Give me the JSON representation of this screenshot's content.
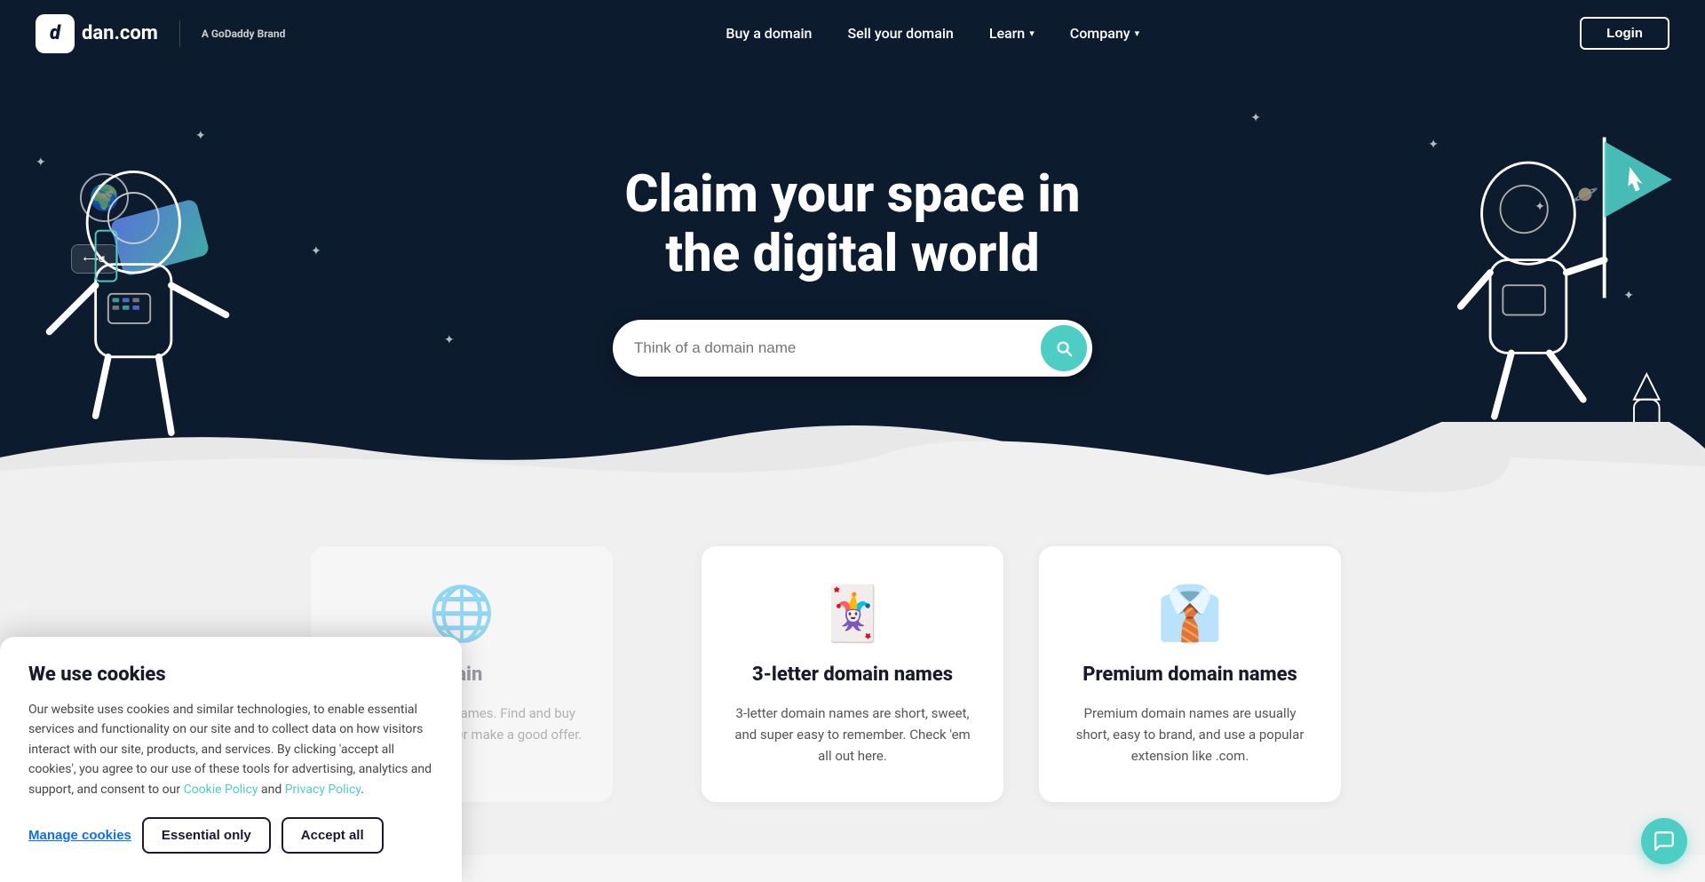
{
  "nav": {
    "logo_text": "dan.com",
    "logo_letter": "d",
    "godaddy_prefix": "A ",
    "godaddy_brand": "GoDaddy",
    "godaddy_suffix": " Brand",
    "links": [
      {
        "label": "Buy a domain",
        "has_dropdown": false
      },
      {
        "label": "Sell your domain",
        "has_dropdown": false
      },
      {
        "label": "Learn",
        "has_dropdown": true
      },
      {
        "label": "Company",
        "has_dropdown": true
      }
    ],
    "login_label": "Login"
  },
  "hero": {
    "title_line1": "Claim your space in",
    "title_line2": "the digital world",
    "search_placeholder": "Think of a domain name"
  },
  "features": [
    {
      "icon": "🃏",
      "title": "3-letter domain names",
      "desc": "3-letter domain names are short, sweet, and super easy to remember. Check 'em all out here."
    },
    {
      "icon": "👔",
      "title": "Premium domain names",
      "desc": "Premium domain names are usually short, easy to brand, and use a popular extension like .com."
    }
  ],
  "cookie": {
    "title": "We use cookies",
    "body": "Our website uses cookies and similar technologies, to enable essential services and functionality on our site and to collect data on how visitors interact with our site, products, and services. By clicking 'accept all cookies', you agree to our use of these tools for advertising, analytics and support, and consent to our ",
    "cookie_policy_link": "Cookie Policy",
    "and_text": " and ",
    "privacy_link": "Privacy Policy",
    "period": ".",
    "manage_label": "Manage cookies",
    "essential_label": "Essential only",
    "accept_label": "Accept all"
  },
  "stars": [
    "✦",
    "✦",
    "✦",
    "✦",
    "✦",
    "✦",
    "✦",
    "✦"
  ],
  "chat": {
    "icon_label": "chat-icon"
  }
}
